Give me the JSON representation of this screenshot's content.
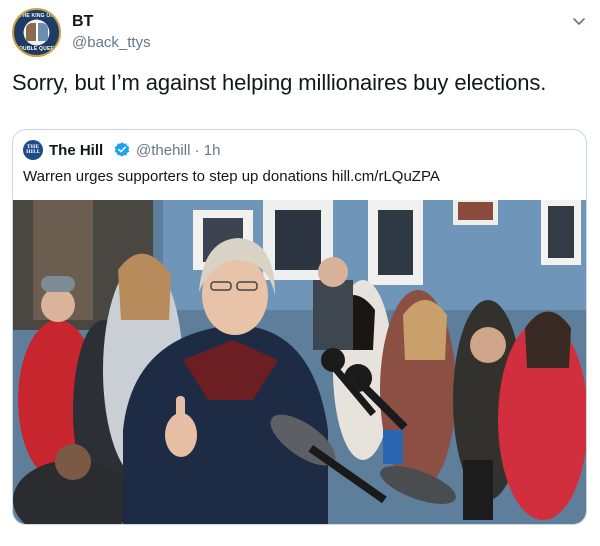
{
  "tweet": {
    "author_name": "BT",
    "author_handle": "@back_ttys",
    "avatar_top_text": "THE KING OF",
    "avatar_bottom_text": "DOUBLE QUEEN",
    "text": "Sorry, but I’m against helping millionaires buy elections."
  },
  "quoted_tweet": {
    "avatar_text": "THE HILL",
    "author_name": "The Hill",
    "verified": true,
    "handle_time": "@thehill · 1h",
    "text": "Warren urges supporters to step up donations hill.cm/rLQuZPA"
  },
  "icons": {
    "menu": "chevron-down-icon",
    "verified": "verified-badge-icon"
  },
  "colors": {
    "text_primary": "#14171a",
    "text_secondary": "#657786",
    "border": "#ccd6dd",
    "verified_blue": "#1da1f2"
  }
}
